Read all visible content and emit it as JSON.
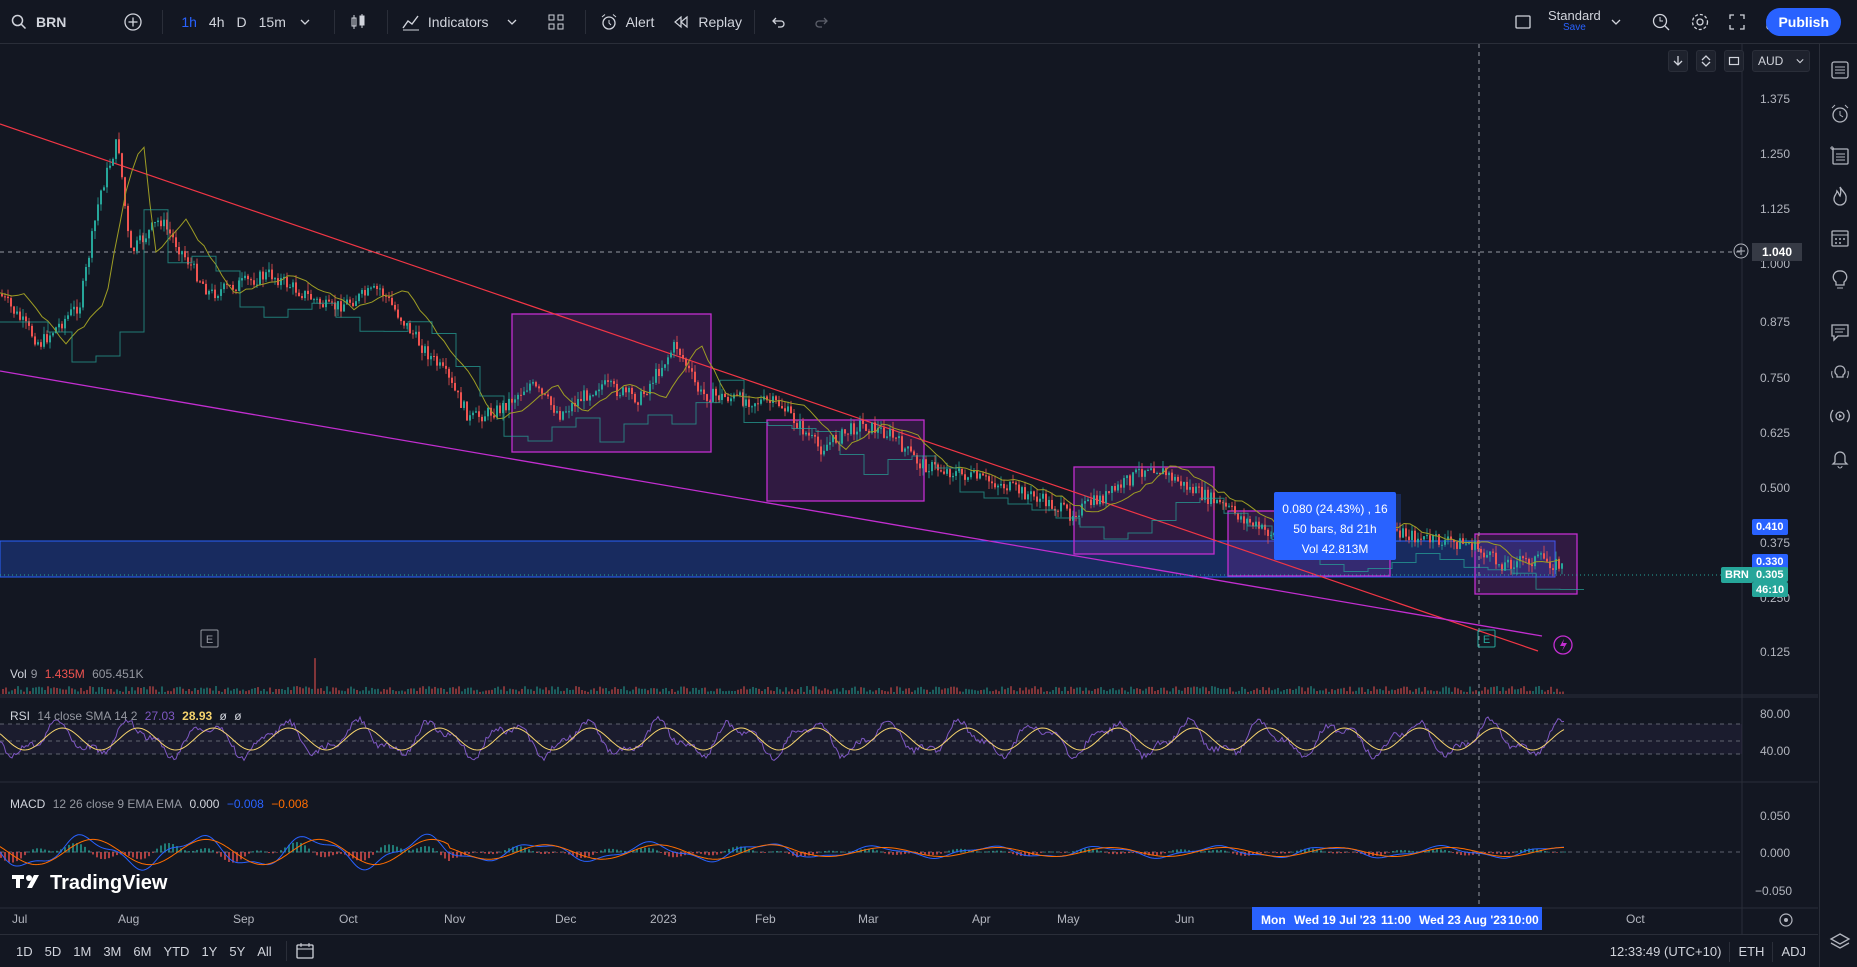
{
  "toolbar": {
    "symbol": "BRN",
    "timeframes": [
      "1h",
      "4h",
      "D",
      "15m"
    ],
    "active_timeframe": "1h",
    "indicators_label": "Indicators",
    "alert_label": "Alert",
    "replay_label": "Replay",
    "layout_name": "Standard",
    "layout_save": "Save",
    "publish_label": "Publish"
  },
  "scale_controls": {
    "currency": "AUD"
  },
  "price_axis": {
    "ticks": [
      "1.375",
      "1.250",
      "1.125",
      "1.000",
      "0.875",
      "0.750",
      "0.625",
      "0.500",
      "0.375",
      "0.250",
      "0.125"
    ],
    "crosshair_price": "1.040",
    "label_high": "0.410",
    "label_mid": "0.330",
    "label_current": "0.305",
    "label_countdown": "46:10",
    "symbol_tag": "BRN"
  },
  "time_axis": {
    "ticks": [
      "Jul",
      "Aug",
      "Sep",
      "Oct",
      "Nov",
      "Dec",
      "2023",
      "Feb",
      "Mar",
      "Apr",
      "May",
      "Jun",
      "Oct"
    ],
    "range_start_day": "Mon",
    "range_start": "Wed 19 Jul '23",
    "range_start_time": "11:00",
    "range_end": "Wed 23 Aug '23",
    "range_end_time": "10:00"
  },
  "measure_tooltip": {
    "line1": "0.080 (24.43%) , 16",
    "line2": "50 bars, 8d 21h",
    "line3": "Vol 42.813M"
  },
  "earnings_marker": "E",
  "volume_pane": {
    "name": "Vol",
    "length": "9",
    "v1": "1.435M",
    "v2": "605.451K"
  },
  "rsi_pane": {
    "name": "RSI",
    "params": "14 close SMA 14 2",
    "v1": "27.03",
    "v2": "28.93",
    "v3": "ø",
    "v4": "ø",
    "ticks": [
      "80.00",
      "40.00"
    ]
  },
  "macd_pane": {
    "name": "MACD",
    "params": "12 26 close 9 EMA EMA",
    "v1": "0.000",
    "v2": "−0.008",
    "v3": "−0.008",
    "ticks": [
      "0.050",
      "0.000",
      "−0.050"
    ]
  },
  "logo_text": "TradingView",
  "bottom": {
    "ranges": [
      "1D",
      "5D",
      "1M",
      "3M",
      "6M",
      "YTD",
      "1Y",
      "5Y",
      "All"
    ],
    "clock": "12:33:49 (UTC+10)",
    "session": "ETH",
    "adj": "ADJ"
  },
  "colors": {
    "background": "#131722",
    "accent": "#2962ff",
    "up": "#26a69a",
    "down": "#ef5350",
    "box": "#c22ed0",
    "trendline": "#f23645"
  }
}
